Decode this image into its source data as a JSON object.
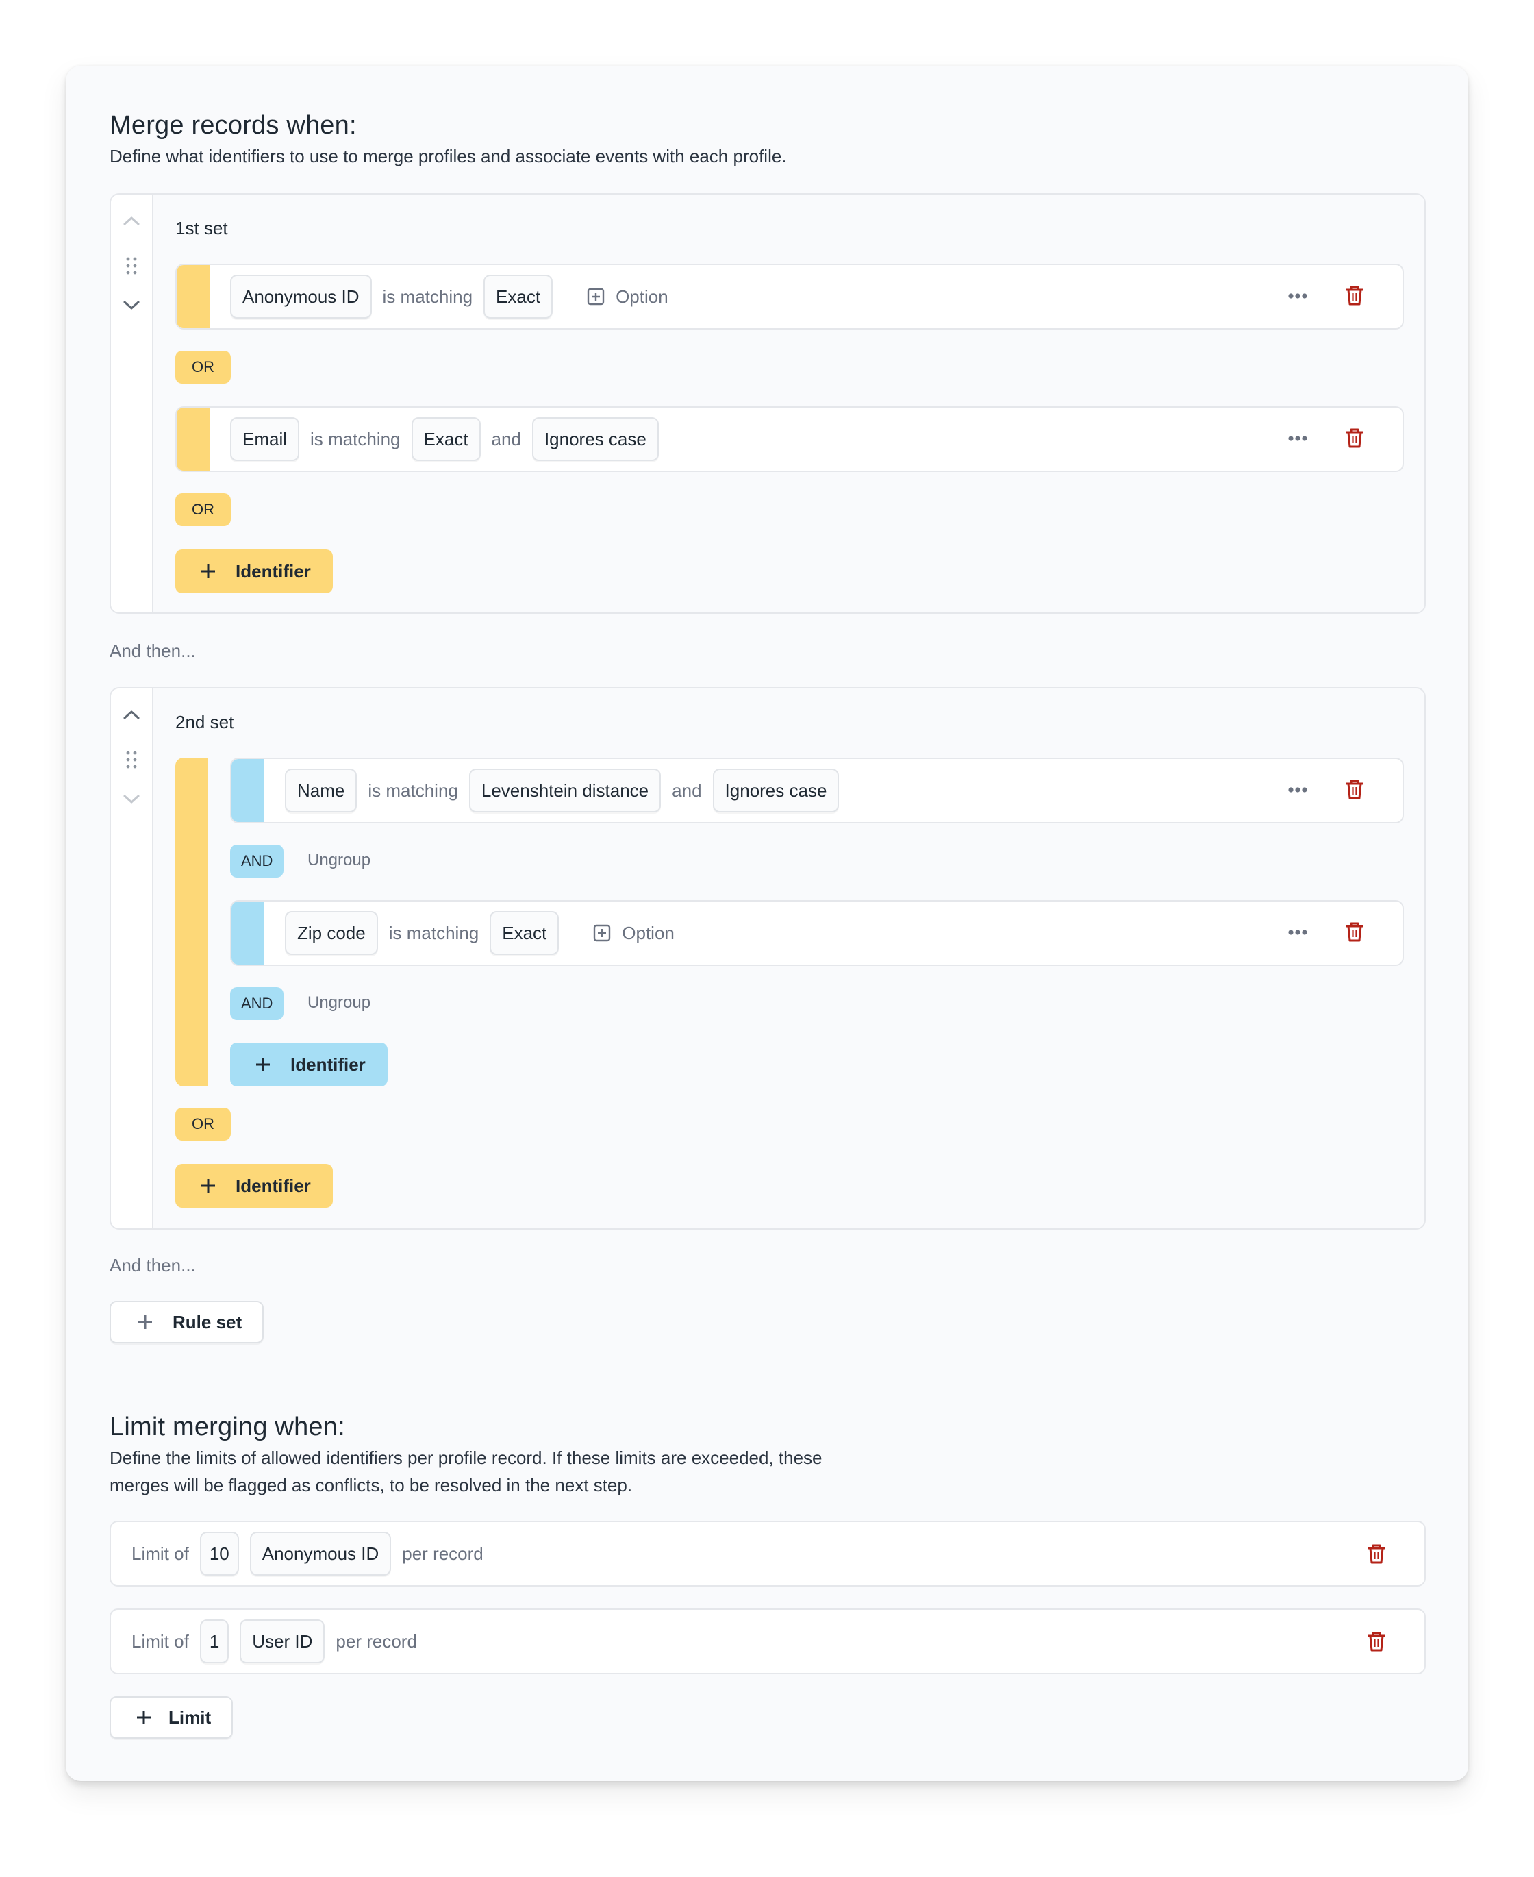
{
  "merge_section": {
    "title": "Merge records when:",
    "description": "Define what identifiers to use to merge profiles and associate events with each profile."
  },
  "sets": [
    {
      "title": "1st set",
      "rows": [
        {
          "identifier": "Anonymous ID",
          "connector": "is matching",
          "match": "Exact",
          "option_label": "Option"
        },
        {
          "identifier": "Email",
          "connector": "is matching",
          "match": "Exact",
          "and_label": "and",
          "modifier": "Ignores case"
        }
      ],
      "or_label": "OR",
      "add_identifier_label": "Identifier"
    },
    {
      "title": "2nd set",
      "group_rows": [
        {
          "identifier": "Name",
          "connector": "is matching",
          "match": "Levenshtein distance",
          "and_label": "and",
          "modifier": "Ignores case"
        },
        {
          "identifier": "Zip code",
          "connector": "is matching",
          "match": "Exact",
          "option_label": "Option"
        }
      ],
      "and_label": "AND",
      "ungroup_label": "Ungroup",
      "group_add_identifier_label": "Identifier",
      "or_label": "OR",
      "add_identifier_label": "Identifier"
    }
  ],
  "and_then_label": "And then...",
  "add_rule_set_label": "Rule set",
  "limit_section": {
    "title": "Limit merging when:",
    "description_line1": "Define the limits of allowed identifiers per profile record. If these limits are exceeded, these",
    "description_line2": "merges will be flagged as conflicts, to be resolved in the next step.",
    "rows": [
      {
        "prefix": "Limit of",
        "count": "10",
        "identifier": "Anonymous ID",
        "suffix": "per record"
      },
      {
        "prefix": "Limit of",
        "count": "1",
        "identifier": "User ID",
        "suffix": "per record"
      }
    ],
    "add_limit_label": "Limit"
  },
  "icons": {
    "move_up": "chevron-up-icon",
    "drag": "drag-handle-icon",
    "move_down": "chevron-down-icon",
    "more": "ellipsis-icon",
    "delete": "trash-icon",
    "add": "plus-icon",
    "option": "plus-square-icon"
  },
  "colors": {
    "or_yellow": "#fdd878",
    "and_blue": "#a6def5",
    "delete_red": "#b42318",
    "card_bg": "#f9fafc",
    "border": "#e5e7eb",
    "muted_text": "#6b7280"
  }
}
